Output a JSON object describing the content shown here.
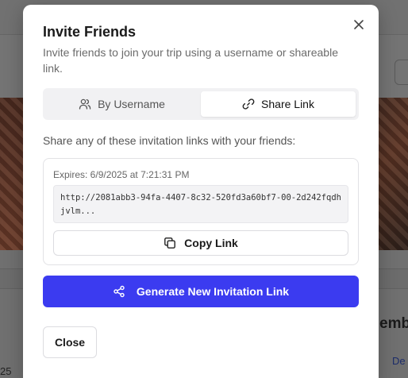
{
  "background": {
    "right_heading_fragment": "emb",
    "right_link_fragment": "De",
    "left_number_fragment": "25"
  },
  "modal": {
    "title": "Invite Friends",
    "subtitle": "Invite friends to join your trip using a username or shareable link.",
    "close_icon": "close-icon",
    "tabs": [
      {
        "label": "By Username",
        "icon": "users-icon",
        "active": false
      },
      {
        "label": "Share Link",
        "icon": "link-icon",
        "active": true
      }
    ],
    "share_description": "Share any of these invitation links with your friends:",
    "link_card": {
      "expires": "Expires: 6/9/2025 at 7:21:31 PM",
      "url": "http://2081abb3-94fa-4407-8c32-520fd3a60bf7-00-2d242fqdhjvlm...",
      "copy_label": "Copy Link"
    },
    "generate_label": "Generate New Invitation Link",
    "close_label": "Close",
    "accent_color": "#3b3bf0"
  }
}
